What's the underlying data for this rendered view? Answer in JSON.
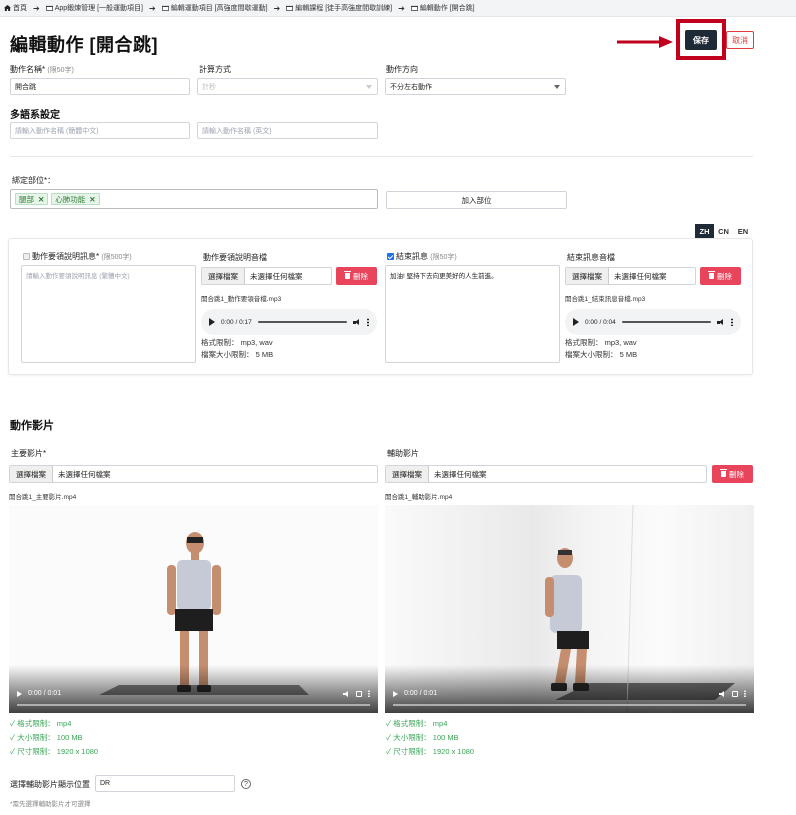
{
  "breadcrumb": {
    "items": [
      {
        "label": "首頁",
        "icon": "home-icon"
      },
      {
        "label": "App鍛煉管理 [一般運動項目]",
        "icon": "folder-icon"
      },
      {
        "label": "編輯運動項目 [高強度間歇運動]",
        "icon": "folder-icon"
      },
      {
        "label": "編輯課程 [徒手高強度間歇訓練]",
        "icon": "folder-icon"
      },
      {
        "label": "編輯動作 [開合跳]",
        "icon": "folder-icon"
      }
    ]
  },
  "page": {
    "title": "編輯動作 [開合跳]",
    "save_label": "保存",
    "cancel_label": "取消"
  },
  "form": {
    "name_label": "動作名稱*",
    "name_hint": "(限50字)",
    "name_value": "開合跳",
    "calc_label": "計算方式",
    "calc_value": "計秒",
    "direction_label": "動作方向",
    "direction_value": "不分左右動作",
    "multilang_title": "多語系設定",
    "name_zh_placeholder": "請輸入動作名稱 (簡體中文)",
    "name_en_placeholder": "請輸入動作名稱 (英文)",
    "parts_label": "綁定部位*：",
    "parts": [
      "腿部",
      "心肺功能"
    ],
    "add_part_label": "加入部位"
  },
  "lang_tabs": [
    "ZH",
    "CN",
    "EN"
  ],
  "lang_active": "ZH",
  "instruction": {
    "checkbox_label": "動作要領說明訊息*",
    "checkbox_hint": "(限500字)",
    "placeholder": "請輸入動作要領說明訊息 (繁體中文)",
    "audio_label": "動作要領說明音檔",
    "choose_label": "選擇檔案",
    "no_file_label": "未選擇任何檔案",
    "delete_label": "刪除",
    "file_name": "開合跳1_動作要領音檔.mp3",
    "audio_time": "0:00 / 0:17",
    "format_limit": "格式限制： mp3, wav",
    "size_limit": "檔案大小限制： 5 MB"
  },
  "ending": {
    "checkbox_label": "結束訊息",
    "checkbox_hint": "(限50字)",
    "text": "加油! 堅持下去向更美好的人生前進。",
    "audio_label": "結束訊息音檔",
    "choose_label": "選擇檔案",
    "no_file_label": "未選擇任何檔案",
    "delete_label": "刪除",
    "file_name": "開合跳1_結束訊息音檔.mp3",
    "audio_time": "0:00 / 0:04",
    "format_limit": "格式限制： mp3, wav",
    "size_limit": "檔案大小限制： 5 MB"
  },
  "video_section": {
    "title": "動作影片",
    "main": {
      "label": "主要影片*",
      "choose_label": "選擇檔案",
      "no_file_label": "未選擇任何檔案",
      "file_name": "開合跳1_主要影片.mp4",
      "time": "0:00 / 0:01"
    },
    "aux": {
      "label": "輔助影片",
      "choose_label": "選擇檔案",
      "no_file_label": "未選擇任何檔案",
      "delete_label": "刪除",
      "file_name": "開合跳1_輔助影片.mp4",
      "time": "0:00 / 0:01"
    },
    "checks": [
      "格式限制： mp4",
      "大小限制： 100 MB",
      "尺寸限制： 1920 x 1080"
    ],
    "aux_position_label": "選擇輔助影片顯示位置",
    "aux_position_value": "DR",
    "aux_position_note": "*需先選擇輔助影片才可選擇"
  },
  "colors": {
    "save_bg": "#1f2a37",
    "highlight": "#c0001d",
    "danger": "#e8455d",
    "success": "#3aa657",
    "tag_bg": "#e6f4ea"
  }
}
